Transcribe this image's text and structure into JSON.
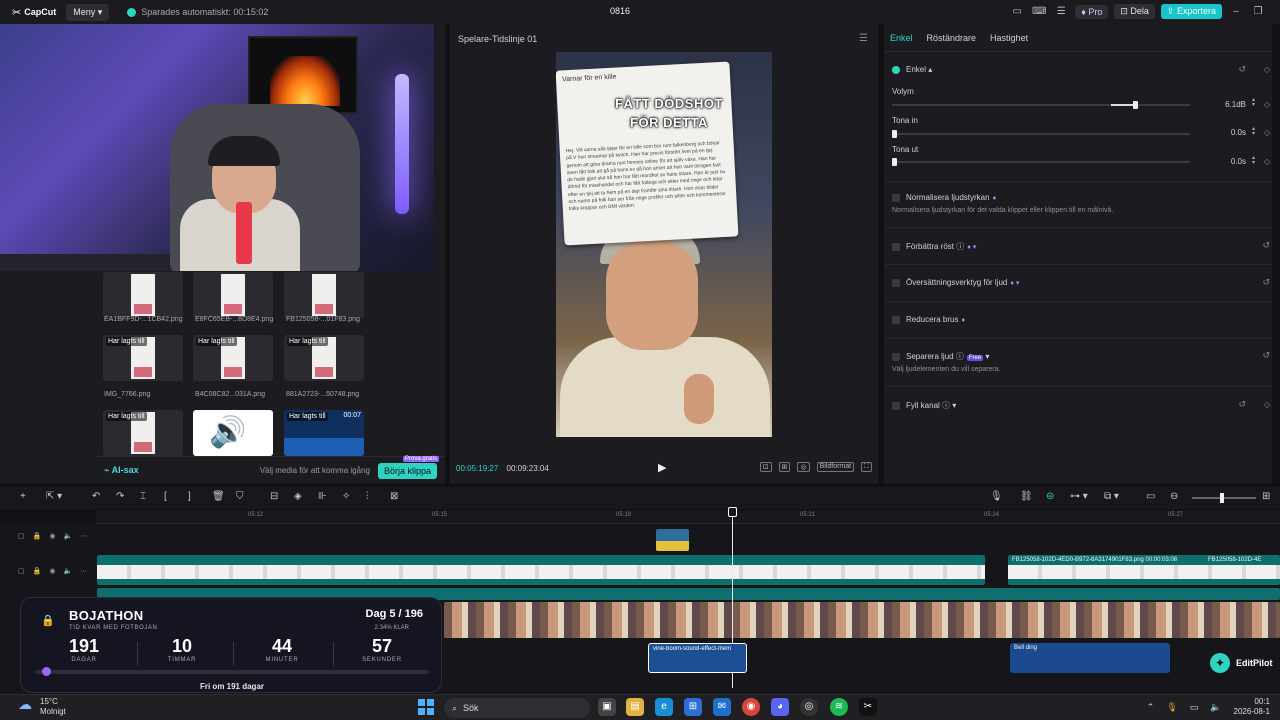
{
  "app": {
    "logo": "CapCut",
    "menu_label": "Meny",
    "autosave": "Sparades automatiskt: 00:15:02",
    "project_title": "0816",
    "pro_label": "Pro",
    "share_label": "Dela",
    "export_label": "Exportera",
    "accent_color": "#2fd3c2"
  },
  "media": {
    "items": [
      {
        "name": "EA1BFF9D-...1CB42.png",
        "badge": ""
      },
      {
        "name": "E8FC65EB-...8D8E4.png",
        "badge": ""
      },
      {
        "name": "FB125058-...01F83.png",
        "badge": ""
      },
      {
        "name": "IMG_7766.png",
        "badge": "Har lagts till"
      },
      {
        "name": "B4C08C82...031A.png",
        "badge": "Har lagts till"
      },
      {
        "name": "881A2723-...50748.png",
        "badge": "Har lagts till"
      },
      {
        "name": "",
        "badge": "Har lagts till"
      },
      {
        "name": "",
        "badge": ""
      },
      {
        "name": "",
        "badge": "Har lagts till",
        "duration": "00:07"
      }
    ],
    "ai_label": "AI-sax",
    "ai_hint": "Välj media för att komma igång",
    "start_button": "Börja klippa",
    "free_tag": "Prova gratis"
  },
  "player": {
    "title": "Spelare-Tidslinje 01",
    "current_time": "00:05:19:27",
    "total_time": "00:09:23:04",
    "ratio_label": "Bildformat",
    "video": {
      "card_header": "Varnar för en kille",
      "caption_line1": "FÅTT DÖDSHOT",
      "caption_line2": "FÖR DETTA",
      "card_text": "Hej. Vill varna alla tjejer för en kille som bor runt falkenberg och börjar på V hon streamar på twitch. Han har precis förstört livet på en tjej genom att göra drama runt hennes online för att själv växa. Han har även fått folk att gå på hans ex då hon anser att hon varit otrogen fast de hade gjort slut så hon har fått mordhot av hans tittare. Han är just nu dömd för misshandel och har fått fotboja och sitter med ringe och letar efter en tjej att ta hem på en dejt framför sina tittare. Hon visar bilder och namn på folk han ser från ringe profiler och sitter och kommenterar folks kroppar och BMI värden."
    }
  },
  "inspector": {
    "tabs": [
      "Enkel",
      "Röständrare",
      "Hastighet"
    ],
    "section_basic": "Enkel",
    "volume_label": "Volym",
    "volume_value": "6.1dB",
    "volume_level": 0.81,
    "fade_in_label": "Tona in",
    "fade_in_value": "0.0s",
    "fade_out_label": "Tona ut",
    "fade_out_value": "0.0s",
    "normalize_label": "Normalisera ljudstyrkan",
    "normalize_desc": "Normalisera ljudstyrkan för det valda klippet eller klippen till en målnivå.",
    "enhance_label": "Förbättra röst",
    "translate_label": "Översättningsverktyg för ljud",
    "denoise_label": "Reducera brus",
    "separate_label": "Separera ljud",
    "separate_tag": "Free",
    "separate_desc": "Välj ljudelementen du vill separera.",
    "fill_label": "Fyll kanal"
  },
  "timeline": {
    "ticks": [
      "05:12",
      "05:15",
      "05:18",
      "05:21",
      "05:24",
      "05:27"
    ],
    "clip_main_label": "FB125058-102D-4ED0-B972-8A3174901F83.png  00:00:03:08",
    "clip_main_label_2": "FB125058-102D-4E",
    "sfx_label": "vine-boom-sound-effect-mem",
    "bell_label": "Bell ding"
  },
  "widget": {
    "title": "BOJATHON",
    "subtitle": "TID KVAR MED FOTBOJAN",
    "day": "Dag 5 / 196",
    "done": "2.34% KLAR",
    "progress": 0.0234,
    "units": [
      {
        "num": "191",
        "label": "DAGAR"
      },
      {
        "num": "10",
        "label": "TIMMAR"
      },
      {
        "num": "44",
        "label": "MINUTER"
      },
      {
        "num": "57",
        "label": "SEKUNDER"
      }
    ],
    "footer": "Fri om 191 dagar"
  },
  "editpilot": {
    "label": "EditPilot"
  },
  "taskbar": {
    "temp": "15°C",
    "condition": "Molnigt",
    "search": "Sök",
    "time": "00:1",
    "date": "2026-08-1"
  }
}
